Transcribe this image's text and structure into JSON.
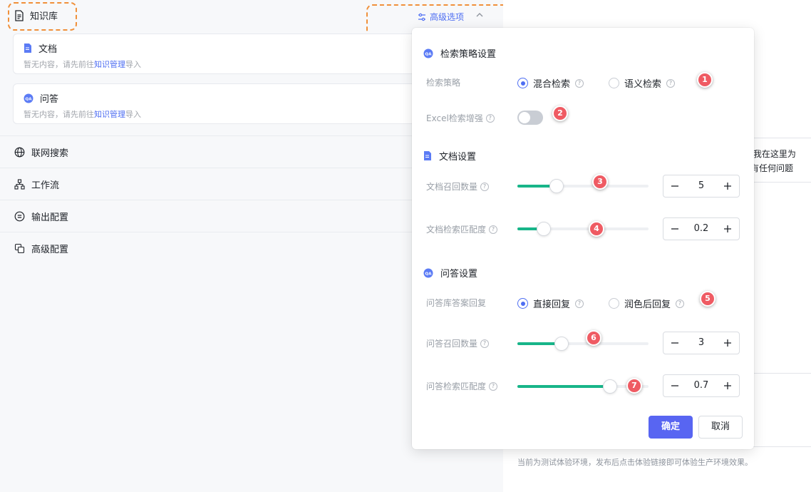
{
  "left": {
    "knowledge_title": "知识库",
    "doc_card": {
      "title": "文档",
      "desc_prefix": "暂无内容，请先前往",
      "desc_link": "知识管理",
      "desc_suffix": "导入"
    },
    "qa_card": {
      "title": "问答",
      "desc_prefix": "暂无内容，请先前往",
      "desc_link": "知识管理",
      "desc_suffix": "导入"
    },
    "sections": [
      "联网搜索",
      "工作流",
      "输出配置",
      "高级配置"
    ],
    "advanced_toggle": "高级选项"
  },
  "right": {
    "bubble_line1": "！ 我在这里为",
    "bubble_line2": "您有任何问题",
    "notice": "当前为测试体验环境，发布后点击体验链接即可体验生产环境效果。"
  },
  "popover": {
    "retrieval": {
      "title": "检索策略设置",
      "strategy_label": "检索策略",
      "options": [
        "混合检索",
        "语义检索"
      ],
      "selected": "混合检索",
      "excel_label": "Excel检索增强",
      "excel_enabled": false
    },
    "doc": {
      "title": "文档设置",
      "recall_label": "文档召回数量",
      "recall_value": "5",
      "match_label": "文档检索匹配度",
      "match_value": "0.2"
    },
    "qa": {
      "title": "问答设置",
      "reply_label": "问答库答案回复",
      "options": [
        "直接回复",
        "润色后回复"
      ],
      "selected": "直接回复",
      "recall_label": "问答召回数量",
      "recall_value": "3",
      "match_label": "问答检索匹配度",
      "match_value": "0.7"
    },
    "confirm": "确定",
    "cancel": "取消"
  },
  "markers": [
    "1",
    "2",
    "3",
    "4",
    "5",
    "6",
    "7"
  ],
  "colors": {
    "accent": "#4e6ef2",
    "slider": "#18b589",
    "marker": "#ef5b63",
    "highlight": "#f0903a",
    "confirm": "#5865f2"
  }
}
